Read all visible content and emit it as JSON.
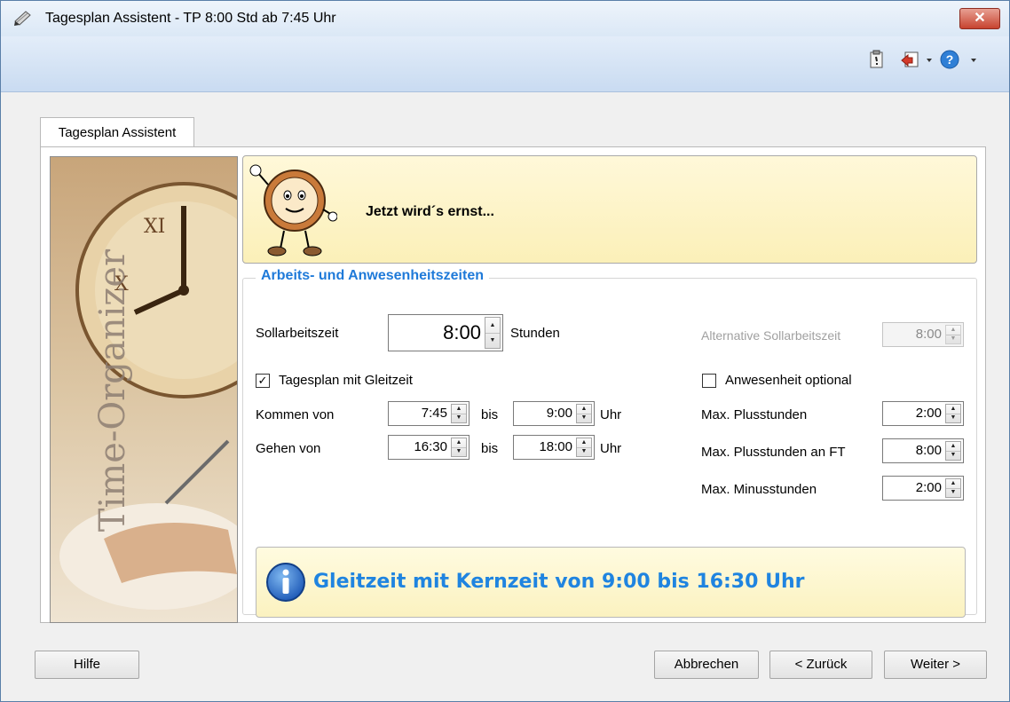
{
  "window": {
    "title": "Tagesplan Assistent - TP 8:00 Std ab 7:45 Uhr",
    "close_glyph": "✕"
  },
  "toolbar": {
    "icons": [
      "clipboard-icon",
      "exit-icon",
      "dropdown-arrow-icon",
      "help-icon",
      "dropdown-arrow-icon"
    ]
  },
  "tab": {
    "label": "Tagesplan Assistent"
  },
  "side_image": {
    "caption": "Time-Organizer"
  },
  "banner": {
    "text": "Jetzt wird´s ernst..."
  },
  "group": {
    "title": "Arbeits- und Anwesenheitszeiten",
    "sollarbeitszeit": {
      "label": "Sollarbeitszeit",
      "value": "8:00",
      "unit": "Stunden"
    },
    "alternative": {
      "label": "Alternative Sollarbeitszeit",
      "value": "8:00"
    },
    "gleitzeit_checkbox": {
      "label": "Tagesplan mit Gleitzeit",
      "checked": true
    },
    "anwesenheit_checkbox": {
      "label": "Anwesenheit optional",
      "checked": false
    },
    "kommen": {
      "label": "Kommen von",
      "from": "7:45",
      "bis": "bis",
      "to": "9:00",
      "unit": "Uhr"
    },
    "gehen": {
      "label": "Gehen von",
      "from": "16:30",
      "bis": "bis",
      "to": "18:00",
      "unit": "Uhr"
    },
    "max_plus": {
      "label": "Max. Plusstunden",
      "value": "2:00"
    },
    "max_plus_ft": {
      "label": "Max. Plusstunden an FT",
      "value": "8:00"
    },
    "max_minus": {
      "label": "Max. Minusstunden",
      "value": "2:00"
    },
    "info": "Gleitzeit mit Kernzeit von 9:00 bis 16:30 Uhr"
  },
  "buttons": {
    "help": "Hilfe",
    "cancel": "Abbrechen",
    "back": "< Zurück",
    "next": "Weiter >"
  },
  "colors": {
    "accent": "#1f84e0",
    "banner_bg": "#fbf0b8",
    "close_red": "#c7432f"
  }
}
